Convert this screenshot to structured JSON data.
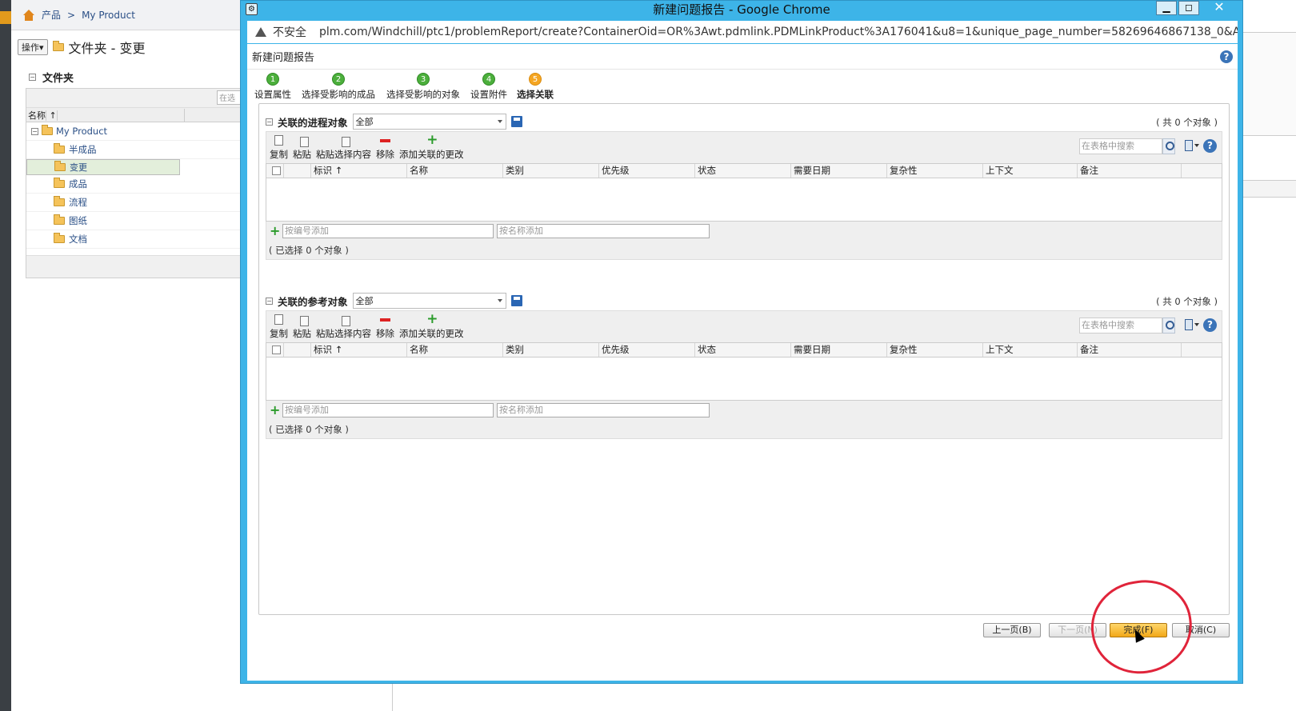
{
  "background": {
    "breadcrumb": {
      "root": "产品",
      "sep": ">",
      "current": "My Product"
    },
    "actions_label": "操作▾",
    "folder_title": "文件夹 - 变更",
    "section_title": "文件夹",
    "search_stub": "在选",
    "column_name": "名称",
    "sort_arrow": "↑",
    "tree": {
      "root": "My Product",
      "items": [
        "半成品",
        "变更",
        "成品",
        "流程",
        "图纸",
        "文档"
      ]
    }
  },
  "chrome": {
    "title": "新建问题报告 - Google Chrome",
    "insecure": "不安全",
    "url": "plm.com/Windchill/ptc1/problemReport/create?ContainerOid=OR%3Awt.pdmlink.PDMLinkProduct%3A176041&u8=1&unique_page_number=58269646867138_0&AjaxEna...",
    "btn_min": "▁",
    "btn_max": "◻",
    "btn_close": "✕"
  },
  "page": {
    "title": "新建问题报告",
    "help": "?",
    "steps": [
      {
        "num": "1",
        "label": "设置属性"
      },
      {
        "num": "2",
        "label": "选择受影响的成品"
      },
      {
        "num": "3",
        "label": "选择受影响的对象"
      },
      {
        "num": "4",
        "label": "设置附件"
      },
      {
        "num": "5",
        "label": "选择关联"
      }
    ],
    "groups": [
      {
        "title": "关联的进程对象",
        "filter": "全部",
        "count": "( 共 0 个对象 )",
        "search_placeholder": "在表格中搜索",
        "add_by_number": "按编号添加",
        "add_by_name": "按名称添加",
        "selected": "( 已选择 0 个对象 )"
      },
      {
        "title": "关联的参考对象",
        "filter": "全部",
        "count": "( 共 0 个对象 )",
        "search_placeholder": "在表格中搜索",
        "add_by_number": "按编号添加",
        "add_by_name": "按名称添加",
        "selected": "( 已选择 0 个对象 )"
      }
    ],
    "toolbar": {
      "copy": "复制",
      "paste": "粘贴",
      "paste_sel": "粘贴选择内容",
      "remove": "移除",
      "add_change": "添加关联的更改"
    },
    "columns": [
      "标识",
      "名称",
      "类别",
      "优先级",
      "状态",
      "需要日期",
      "复杂性",
      "上下文",
      "备注"
    ],
    "nav": {
      "prev": "上一页(B)",
      "next": "下一页(N)",
      "finish": "完成(F)",
      "cancel": "取消(C)"
    }
  },
  "colors": {
    "chrome_frame": "#3db4e8",
    "step_done": "#4caf3c",
    "step_current": "#f5a623",
    "annotation": "#e0243a"
  }
}
